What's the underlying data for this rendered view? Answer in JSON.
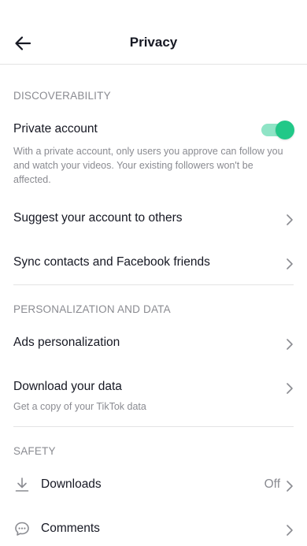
{
  "header": {
    "title": "Privacy",
    "back_icon": "arrow-left-icon"
  },
  "sections": {
    "discoverability": {
      "title": "DISCOVERABILITY",
      "private_account": {
        "label": "Private account",
        "description": "With a private account, only users you approve can follow you and watch your videos. Your existing followers won't be affected.",
        "enabled": true
      },
      "suggest": {
        "label": "Suggest your account to others"
      },
      "sync": {
        "label": "Sync contacts and Facebook friends"
      }
    },
    "personalization": {
      "title": "PERSONALIZATION AND DATA",
      "ads": {
        "label": "Ads personalization"
      },
      "download_data": {
        "label": "Download your data",
        "description": "Get a copy of your TikTok data"
      }
    },
    "safety": {
      "title": "SAFETY",
      "downloads": {
        "label": "Downloads",
        "value": "Off",
        "icon": "download-icon"
      },
      "comments": {
        "label": "Comments",
        "icon": "comment-icon"
      }
    }
  },
  "colors": {
    "toggle_on": "#21c888",
    "toggle_track": "#8fe4c6",
    "secondary_text": "#8a8b91",
    "divider": "#e3e3e4"
  }
}
